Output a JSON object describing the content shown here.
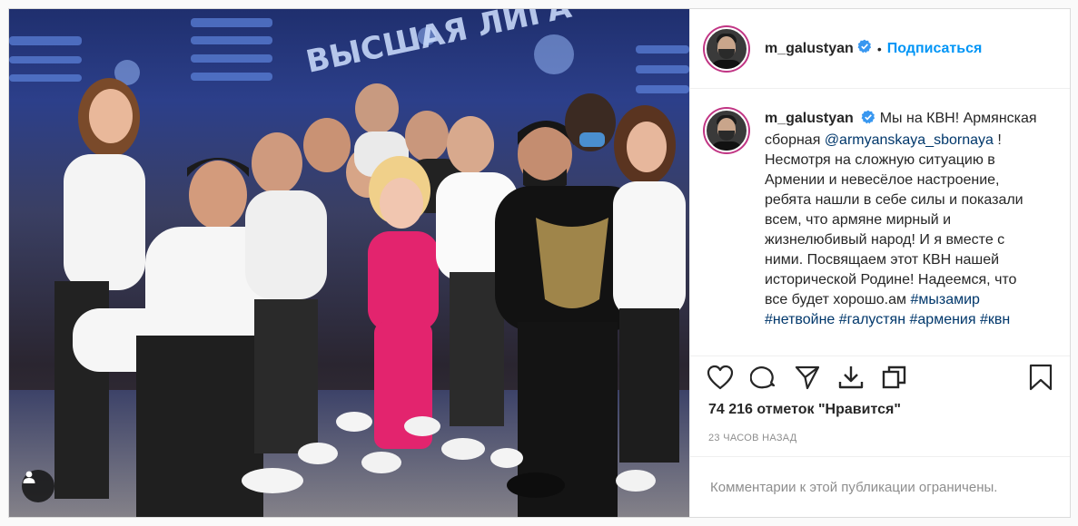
{
  "post": {
    "username": "m_galustyan",
    "follow_label": "Подписаться",
    "separator": "•",
    "photo_alt": "",
    "caption": {
      "text_1": "Мы на КВН! Армянская сборная",
      "mention": "@armyanskaya_sbornaya",
      "text_2": "! Несмотря на сложную ситуацию в Армении и невесёлое настроение, ребята нашли в себе силы и показали всем, что армяне мирный и жизнелюбивый народ! И я вместе с ними. Посвящаем этот КВН нашей исторической Родине! Надеемся, что все будет хорошо.ам",
      "hashtags": [
        "#мызамир",
        "#нетвойне",
        "#галустян",
        "#армения",
        "#квн"
      ]
    },
    "likes": "74 216 отметок \"Нравится\"",
    "time": "23 часов назад",
    "comments_restricted": "Комментарии к этой публикации ограничены."
  },
  "colors": {
    "accent": "#0095f6",
    "link": "#00376b",
    "muted": "#8e8e8e"
  },
  "icons": [
    "heart-icon",
    "comment-icon",
    "share-icon",
    "download-icon",
    "copy-icon",
    "bookmark-icon",
    "user-tag-icon",
    "verified-badge-icon"
  ]
}
